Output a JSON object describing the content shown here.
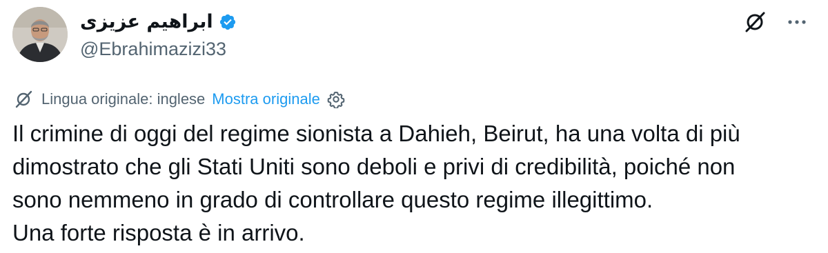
{
  "author": {
    "display_name": "ابراهیم عزیزی",
    "handle": "@Ebrahimazizi33",
    "verified": true
  },
  "icons": {
    "verified": "verified-badge-icon",
    "grok": "grok-icon",
    "more": "more-horizontal-icon",
    "translate": "translate-icon",
    "settings": "settings-gear-icon"
  },
  "translation": {
    "label": "Lingua originale: inglese",
    "show_original": "Mostra originale"
  },
  "tweet": {
    "lines": [
      "Il crimine di oggi del regime sionista a Dahieh, Beirut, ha una volta di più",
      "dimostrato che gli Stati Uniti sono deboli e privi di credibilità, poiché non",
      "sono nemmeno in grado di controllare questo regime illegittimo.",
      "Una forte risposta è in arrivo."
    ]
  },
  "colors": {
    "text": "#0f1419",
    "secondary": "#536471",
    "link": "#1d9bf0",
    "verified": "#1d9bf0"
  }
}
